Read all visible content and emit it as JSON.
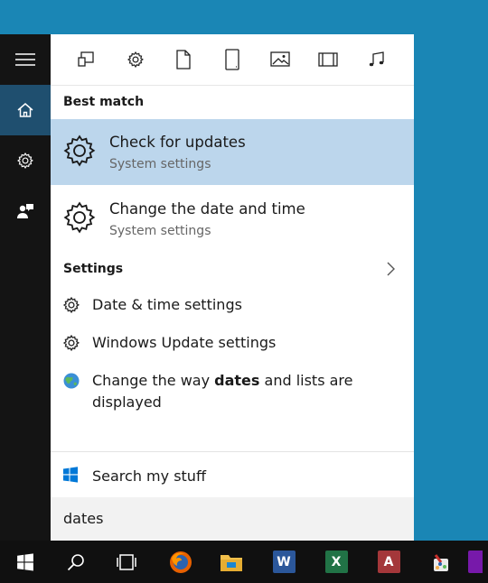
{
  "filters": [
    {
      "name": "apps-filter-icon"
    },
    {
      "name": "settings-filter-icon"
    },
    {
      "name": "documents-filter-icon"
    },
    {
      "name": "tablet-filter-icon"
    },
    {
      "name": "photos-filter-icon"
    },
    {
      "name": "videos-filter-icon"
    },
    {
      "name": "music-filter-icon"
    }
  ],
  "best_match": {
    "title": "Best match",
    "results": [
      {
        "title": "Check for updates",
        "subtitle": "System settings",
        "selected": true
      },
      {
        "title": "Change the date and time",
        "subtitle": "System settings",
        "selected": false
      }
    ]
  },
  "settings": {
    "title": "Settings",
    "items": [
      {
        "label": "Date & time settings",
        "icon": "gear-icon"
      },
      {
        "label": "Windows Update settings",
        "icon": "gear-icon"
      },
      {
        "label_before": "Change the way ",
        "label_bold": "dates",
        "label_after": " and lists are displayed",
        "icon": "globe-icon"
      }
    ]
  },
  "search_my_stuff": "Search my stuff",
  "search_query": "dates",
  "taskbar": {
    "items": [
      "start-button",
      "search-button",
      "task-view-button",
      "firefox-icon",
      "file-explorer-icon",
      "word-icon",
      "excel-icon",
      "access-icon",
      "paint-icon",
      "onenote-icon"
    ],
    "word_letter": "W",
    "excel_letter": "X",
    "access_letter": "A"
  },
  "colors": {
    "desktop": "#1a86b5",
    "rail": "#141414",
    "selected": "#bcd6ec",
    "accent": "#0078d7",
    "taskbar": "#101010"
  }
}
